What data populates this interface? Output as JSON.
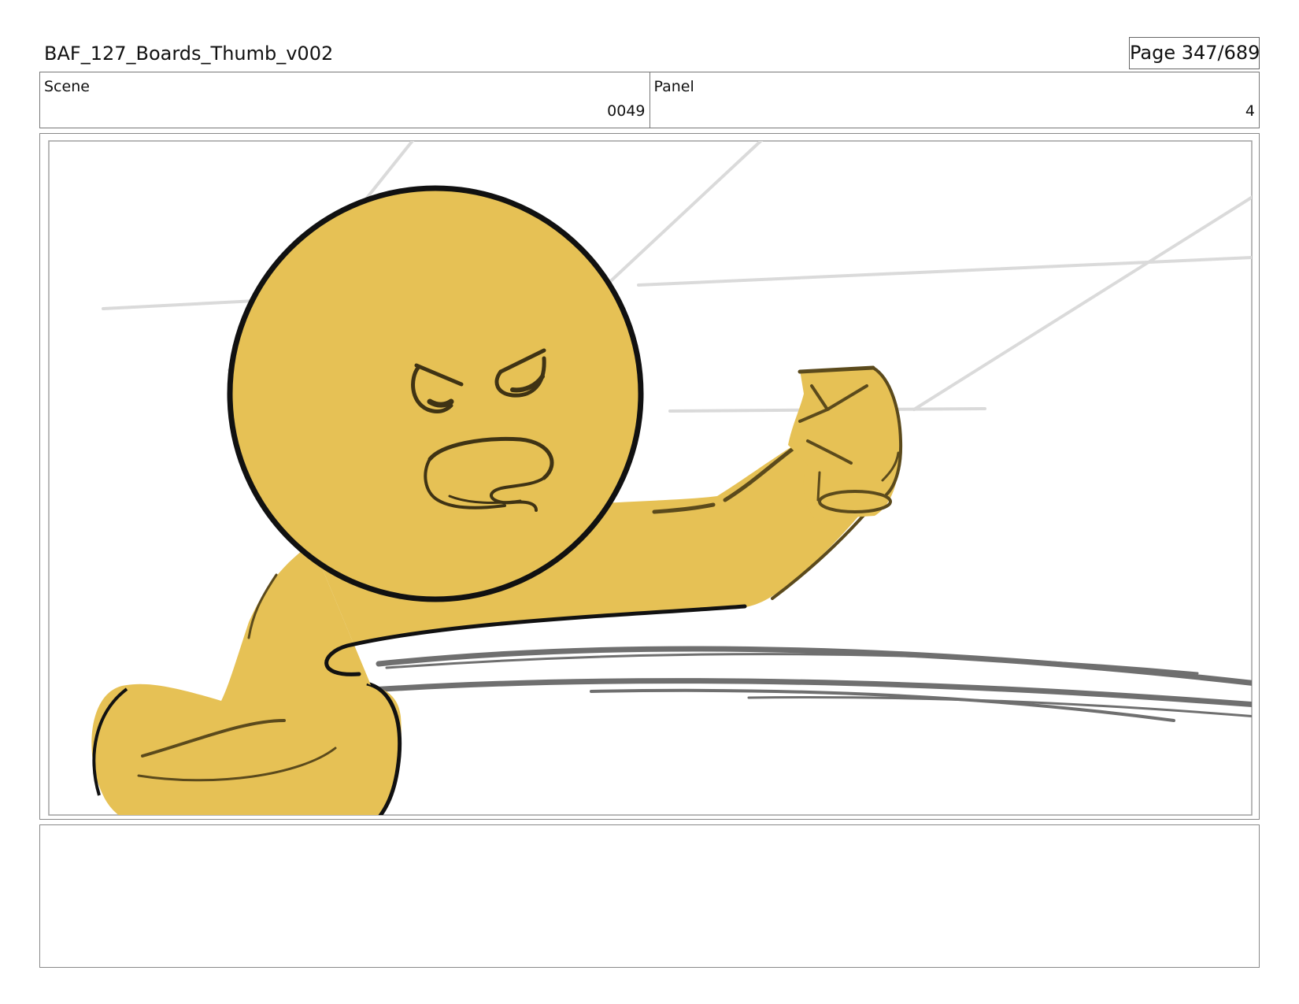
{
  "header": {
    "document_title": "BAF_127_Boards_Thumb_v002",
    "page_number": "Page 347/689"
  },
  "info": {
    "scene_label": "Scene",
    "scene_value": "0049",
    "panel_label": "Panel",
    "panel_value": "4"
  },
  "panel_image": {
    "subject": "yellow-character-angry-pointing",
    "colors": {
      "character_fill": "#e6c155",
      "outline": "#111111",
      "background_lines": "#d9d9d9",
      "motion_lines": "#777777"
    }
  },
  "notes": {
    "text": ""
  }
}
